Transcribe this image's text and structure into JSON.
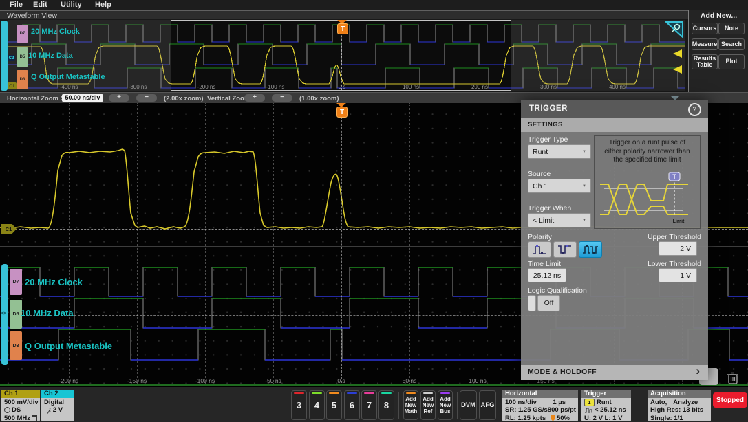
{
  "menu": {
    "items": [
      "File",
      "Edit",
      "Utility",
      "Help"
    ]
  },
  "view_title": "Waveform View",
  "overview": {
    "ticks": [
      "-400 ns",
      "-300 ns",
      "-200 ns",
      "-100 ns",
      "0 s",
      "100 ns",
      "200 ns",
      "300 ns",
      "400 ns"
    ],
    "trigger_marker": "T",
    "c1_marker": "C1",
    "c2_marker": "C2"
  },
  "zoom_bar": {
    "h_label": "Horizontal Zoom Scale",
    "h_value": "50.00 ns/div",
    "plus": "+",
    "minus": "−",
    "h_zoom": "(2.00x zoom)",
    "v_label": "Vertical Zoom",
    "v_zoom": "(1.00x zoom)"
  },
  "add_new": {
    "title": "Add New...",
    "buttons": [
      "Cursors",
      "Note",
      "Measure",
      "Search",
      "Results Table",
      "Plot"
    ]
  },
  "digital_channels": [
    {
      "id": "D7",
      "label": "20 MHz Clock",
      "color": "#c791c2"
    },
    {
      "id": "D5",
      "label": "10 MHz Data",
      "color": "#93c093"
    },
    {
      "id": "D3",
      "label": "Q Output Metastable",
      "color": "#e0824c"
    }
  ],
  "main_view": {
    "ticks": [
      "-200 ns",
      "-150 ns",
      "-100 ns",
      "-50 ns",
      "0 s",
      "50 ns",
      "100 ns",
      "150 ns"
    ],
    "trigger_marker": "T",
    "c1_marker": "C1",
    "d5_handle": "<>"
  },
  "trigger_panel": {
    "title": "TRIGGER",
    "help_icon": "?",
    "section": "SETTINGS",
    "trigger_type_label": "Trigger Type",
    "trigger_type_value": "Runt",
    "source_label": "Source",
    "source_value": "Ch 1",
    "trigger_when_label": "Trigger When",
    "trigger_when_value": "< Limit",
    "description": "Trigger on a runt pulse of either polarity narrower than the specified time limit",
    "illustration_limit_label": "Limit",
    "illustration_trigger_marker": "T",
    "polarity_label": "Polarity",
    "upper_threshold_label": "Upper Threshold",
    "upper_threshold_value": "2 V",
    "time_limit_label": "Time Limit",
    "time_limit_value": "25.12 ns",
    "lower_threshold_label": "Lower Threshold",
    "lower_threshold_value": "1 V",
    "logic_label": "Logic Qualification",
    "logic_value": "Off",
    "footer": "MODE & HOLDOFF",
    "chevron": "›",
    "caret": "▼"
  },
  "bottom_bar": {
    "ch1": {
      "title": "Ch 1",
      "line1": "500 mV/div",
      "line2": "DS",
      "line3": "500 MHz"
    },
    "ch2": {
      "title": "Ch 2",
      "line1": "Digital",
      "line2": ": 2 V"
    },
    "channel_buttons": [
      {
        "label": "3",
        "stripe": "#e0252c"
      },
      {
        "label": "4",
        "stripe": "#7ddc2a"
      },
      {
        "label": "5",
        "stripe": "#f08a1e"
      },
      {
        "label": "6",
        "stripe": "#2b3ed6"
      },
      {
        "label": "7",
        "stripe": "#e83c9a"
      },
      {
        "label": "8",
        "stripe": "#19d6a0"
      }
    ],
    "add_buttons": [
      {
        "lines": [
          "Add",
          "New",
          "Math"
        ],
        "stripe": "#f08a1e"
      },
      {
        "lines": [
          "Add",
          "New",
          "Ref"
        ],
        "stripe": "#cfcfcf"
      },
      {
        "lines": [
          "Add",
          "New",
          "Bus"
        ],
        "stripe": "#9a3cf0"
      }
    ],
    "dvm": "DVM",
    "afg": "AFG",
    "horizontal": {
      "title": "Horizontal",
      "r1c1": "100 ns/div",
      "r1c2": "1 µs",
      "r2c1": "SR: 1.25 GS/s",
      "r2c2": "800 ps/pt",
      "r3c1": "RL: 1.25 kpts",
      "r3c2": "50%"
    },
    "trigger": {
      "title": "Trigger",
      "source_num": "1",
      "r1": "Runt",
      "r2": "< 25.12 ns",
      "r3": "U: 2 V  L: 1 V"
    },
    "acquisition": {
      "title": "Acquisition",
      "r1a": "Auto,",
      "r1b": "Analyze",
      "r2": "High Res: 13 bits",
      "r3": "Single: 1/1"
    },
    "stopped": "Stopped"
  }
}
